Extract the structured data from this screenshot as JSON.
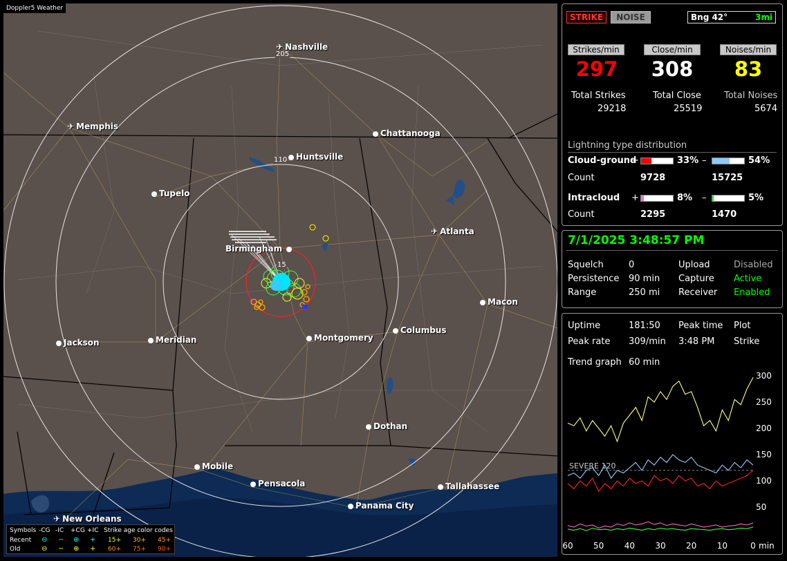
{
  "map": {
    "title": "Doppler5 Weather",
    "cities": [
      {
        "name": "Nashville",
        "icon": "airport-icon"
      },
      {
        "name": "Memphis",
        "icon": "airport-icon"
      },
      {
        "name": "Chattanooga",
        "icon": "city-dot-icon"
      },
      {
        "name": "Huntsville",
        "icon": "city-dot-icon"
      },
      {
        "name": "Tupelo",
        "icon": "city-dot-icon"
      },
      {
        "name": "Atlanta",
        "icon": "airport-icon"
      },
      {
        "name": "Birmingham",
        "icon": "city-dot-icon"
      },
      {
        "name": "Macon",
        "icon": "city-dot-icon"
      },
      {
        "name": "Jackson",
        "icon": "city-dot-icon"
      },
      {
        "name": "Meridian",
        "icon": "city-dot-icon"
      },
      {
        "name": "Montgomery",
        "icon": "city-dot-icon"
      },
      {
        "name": "Columbus",
        "icon": "city-dot-icon"
      },
      {
        "name": "Dothan",
        "icon": "city-dot-icon"
      },
      {
        "name": "Mobile",
        "icon": "city-dot-icon"
      },
      {
        "name": "Pensacola",
        "icon": "city-dot-icon"
      },
      {
        "name": "Tallahassee",
        "icon": "city-dot-icon"
      },
      {
        "name": "Panama City",
        "icon": "city-dot-icon"
      },
      {
        "name": "New Orleans",
        "icon": "airport-icon"
      }
    ],
    "ring_labels": [
      "205",
      "110",
      "15"
    ],
    "legend": {
      "symbols_label": "Symbols",
      "cols": [
        "-CG",
        "-IC",
        "+CG",
        "+IC"
      ],
      "age_label": "Strike age color codes",
      "recent_label": "Recent",
      "old_label": "Old",
      "recent_ages": [
        "15+",
        "30+",
        "45+"
      ],
      "old_ages": [
        "60+",
        "75+",
        "90+"
      ]
    }
  },
  "panel1": {
    "strike_btn": "STRIKE",
    "noise_btn": "NOISE",
    "bearing": "Bng 42°",
    "range_mi": "3mi",
    "strikes_min_label": "Strikes/min",
    "close_min_label": "Close/min",
    "noises_min_label": "Noises/min",
    "strikes_min": "297",
    "close_min": "308",
    "noises_min": "83",
    "total_strikes_label": "Total Strikes",
    "total_close_label": "Total Close",
    "total_noises_label": "Total Noises",
    "total_strikes": "29218",
    "total_close": "25519",
    "total_noises": "5674",
    "dist_title": "Lightning type distribution",
    "cg_label": "Cloud-ground",
    "ic_label": "Intracloud",
    "count_label": "Count",
    "plus": "+",
    "minus": "–",
    "cg_pos_pct": "33%",
    "cg_neg_pct": "54%",
    "cg_pos_count": "9728",
    "cg_neg_count": "15725",
    "ic_pos_pct": "8%",
    "ic_neg_pct": "5%",
    "ic_pos_count": "2295",
    "ic_neg_count": "1470",
    "bars": {
      "cg_pos": 0.33,
      "cg_neg": 0.54,
      "ic_pos": 0.08,
      "ic_neg": 0.05
    },
    "colors": {
      "strike": "#ff0000",
      "close": "#ffffff",
      "noise": "#ffff00",
      "cg_pos": "#ff0000",
      "cg_neg": "#88ccff",
      "ic_pos": "#ff66cc",
      "ic_neg": "#00ff00"
    }
  },
  "panel2": {
    "datetime": "7/1/2025 3:48:57 PM",
    "squelch_label": "Squelch",
    "squelch": "0",
    "persistence_label": "Persistence",
    "persistence": "90 min",
    "range_label": "Range",
    "range": "250 mi",
    "upload_label": "Upload",
    "upload": "Disabled",
    "capture_label": "Capture",
    "capture": "Active",
    "receiver_label": "Receiver",
    "receiver": "Enabled"
  },
  "panel3": {
    "uptime_label": "Uptime",
    "uptime": "181:50",
    "peak_time_label": "Peak time",
    "peak_time": "3:48 PM",
    "plot_label": "Plot",
    "plot": "Strike",
    "peak_rate_label": "Peak rate",
    "peak_rate": "309/min",
    "trend_label": "Trend graph",
    "trend": "60 min",
    "severe_label": "SEVERE 120",
    "y_ticks": [
      "300",
      "250",
      "200",
      "150",
      "100",
      "50"
    ],
    "x_ticks": [
      "60",
      "50",
      "40",
      "30",
      "20",
      "10",
      "0"
    ],
    "x_unit": "min"
  },
  "chart_data": {
    "type": "line",
    "x": [
      60,
      58,
      56,
      54,
      52,
      50,
      48,
      46,
      44,
      42,
      40,
      38,
      36,
      34,
      32,
      30,
      28,
      26,
      24,
      22,
      20,
      18,
      16,
      14,
      12,
      10,
      8,
      6,
      4,
      2,
      0
    ],
    "series": [
      {
        "values": [
          210,
          205,
          220,
          195,
          215,
          200,
          185,
          205,
          175,
          210,
          225,
          240,
          215,
          260,
          250,
          270,
          255,
          280,
          290,
          265,
          270,
          240,
          205,
          215,
          195,
          235,
          215,
          255,
          245,
          275,
          297
        ]
      },
      {
        "values": [
          110,
          115,
          105,
          120,
          125,
          110,
          130,
          105,
          120,
          115,
          125,
          135,
          120,
          140,
          130,
          145,
          135,
          150,
          140,
          135,
          145,
          130,
          125,
          120,
          115,
          130,
          120,
          135,
          125,
          140,
          130
        ]
      },
      {
        "values": [
          95,
          85,
          100,
          90,
          105,
          80,
          95,
          85,
          100,
          90,
          105,
          95,
          100,
          90,
          110,
          100,
          105,
          95,
          110,
          100,
          105,
          90,
          95,
          85,
          100,
          90,
          95,
          100,
          105,
          110,
          120
        ]
      },
      {
        "values": [
          15,
          12,
          18,
          14,
          16,
          10,
          14,
          12,
          18,
          15,
          20,
          16,
          18,
          22,
          17,
          20,
          15,
          18,
          16,
          14,
          18,
          15,
          12,
          14,
          16,
          12,
          14,
          15,
          18,
          16,
          20
        ]
      },
      {
        "values": [
          8,
          6,
          9,
          5,
          10,
          7,
          8,
          6,
          9,
          7,
          10,
          8,
          6,
          9,
          7,
          10,
          8,
          9,
          7,
          6,
          9,
          8,
          7,
          6,
          8,
          9,
          7,
          8,
          10,
          9,
          12
        ]
      }
    ],
    "ylim": [
      0,
      300
    ],
    "severe": 120
  }
}
